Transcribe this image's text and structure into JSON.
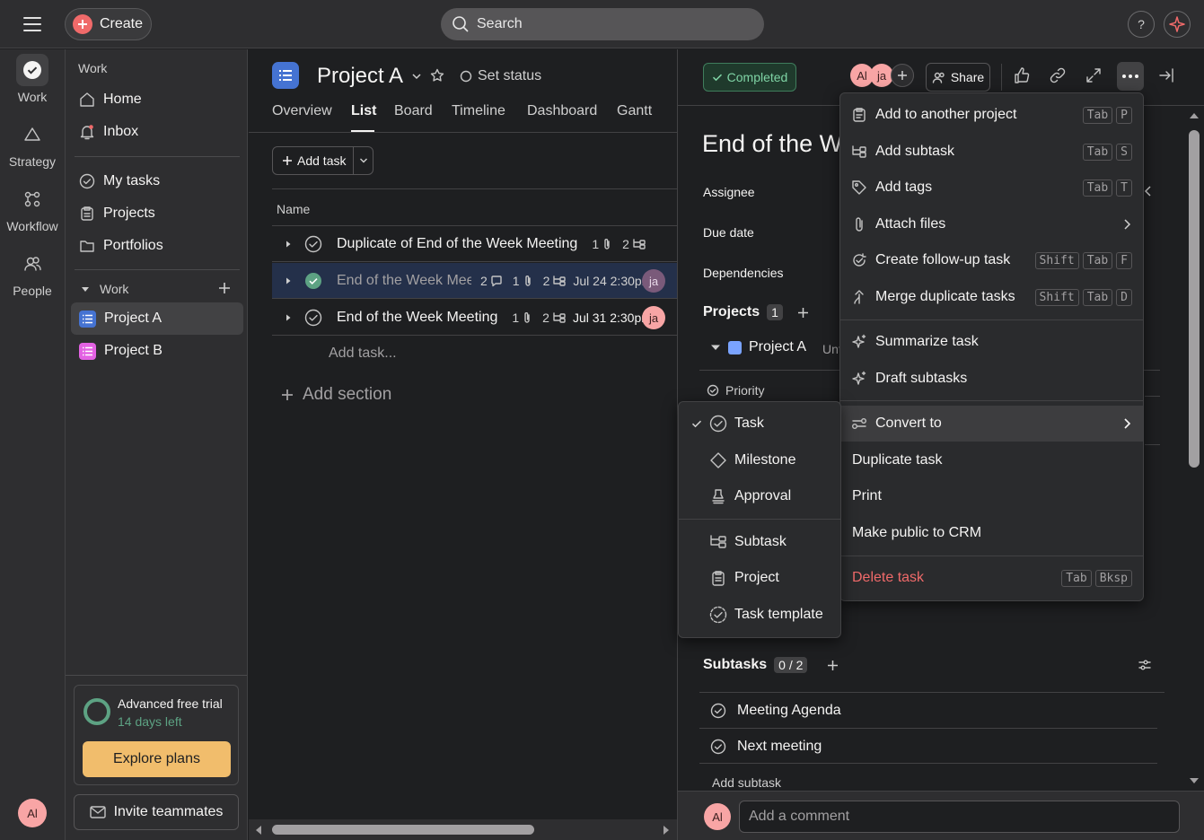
{
  "topbar": {
    "create_label": "Create",
    "search_placeholder": "Search",
    "help_label": "?"
  },
  "rail": {
    "items": [
      {
        "label": "Work",
        "icon": "check-circle-icon"
      },
      {
        "label": "Strategy",
        "icon": "triangle-icon"
      },
      {
        "label": "Workflow",
        "icon": "workflow-icon"
      },
      {
        "label": "People",
        "icon": "people-icon"
      }
    ],
    "avatar": "Al"
  },
  "sidebar": {
    "heading": "Work",
    "top_items": [
      {
        "label": "Home"
      },
      {
        "label": "Inbox"
      }
    ],
    "mid_items": [
      {
        "label": "My tasks"
      },
      {
        "label": "Projects"
      },
      {
        "label": "Portfolios"
      }
    ],
    "section_label": "Work",
    "projects": [
      {
        "label": "Project A",
        "color": "#4573d2"
      },
      {
        "label": "Project B",
        "color": "#e362e3"
      }
    ],
    "trial": {
      "title": "Advanced free trial",
      "days_left": "14 days left",
      "cta": "Explore plans"
    },
    "invite_label": "Invite teammates"
  },
  "main": {
    "project_title": "Project A",
    "set_status": "Set status",
    "tabs": [
      "Overview",
      "List",
      "Board",
      "Timeline",
      "Dashboard",
      "Gantt"
    ],
    "add_task_label": "Add task",
    "column_name": "Name",
    "rows": [
      {
        "name": "Duplicate of End of the Week Meeting",
        "comments": "",
        "attachments": "1",
        "subtasks": "2",
        "date": "",
        "assignee": ""
      },
      {
        "name": "End of the Week Mee",
        "comments": "2",
        "attachments": "1",
        "subtasks": "2",
        "date": "Jul 24 2:30pm",
        "assignee": "ja"
      },
      {
        "name": "End of the Week Meeting",
        "comments": "",
        "attachments": "1",
        "subtasks": "2",
        "date": "Jul 31 2:30pm",
        "assignee": "ja"
      }
    ],
    "add_task_row": "Add task...",
    "add_section": "Add section"
  },
  "detail": {
    "completed_label": "Completed",
    "avatars": [
      "Al",
      "ja"
    ],
    "share_label": "Share",
    "title": "End of the W",
    "fields": {
      "assignee": "Assignee",
      "due_date": "Due date",
      "dependencies": "Dependencies"
    },
    "projects_label": "Projects",
    "projects_count": "1",
    "project_name": "Project A",
    "project_section_partial": "Unt",
    "priority_label": "Priority",
    "subtasks_label": "Subtasks",
    "subtasks_count": "0 / 2",
    "subtasks": [
      "Meeting Agenda",
      "Next meeting"
    ],
    "add_subtask": "Add subtask",
    "comment_avatar": "Al",
    "comment_placeholder": "Add a comment"
  },
  "more_menu": {
    "items": [
      {
        "label": "Add to another project",
        "keys": [
          "Tab",
          "P"
        ]
      },
      {
        "label": "Add subtask",
        "keys": [
          "Tab",
          "S"
        ]
      },
      {
        "label": "Add tags",
        "keys": [
          "Tab",
          "T"
        ]
      },
      {
        "label": "Attach files",
        "keys": []
      },
      {
        "label": "Create follow-up task",
        "keys": [
          "Shift",
          "Tab",
          "F"
        ]
      },
      {
        "label": "Merge duplicate tasks",
        "keys": [
          "Shift",
          "Tab",
          "D"
        ]
      }
    ],
    "ai_items": [
      "Summarize task",
      "Draft subtasks"
    ],
    "convert_to": "Convert to",
    "plain_items": [
      "Duplicate task",
      "Print",
      "Make public to CRM"
    ],
    "delete_label": "Delete task",
    "delete_keys": [
      "Tab",
      "Bksp"
    ],
    "delete_color": "#f06a6a"
  },
  "convert_menu": {
    "items": [
      "Task",
      "Milestone",
      "Approval"
    ],
    "items2": [
      "Subtask",
      "Project",
      "Task template"
    ],
    "selected": "Task"
  }
}
